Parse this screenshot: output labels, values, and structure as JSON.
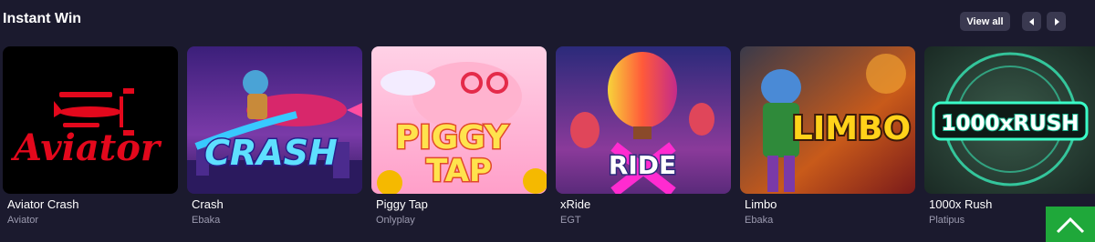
{
  "section": {
    "title": "Instant Win",
    "view_all_label": "View all"
  },
  "colors": {
    "background": "#1b1a2e",
    "button_bg": "#3a3950",
    "provider_text": "#9c9bb0",
    "scroll_top_bg": "#1fa83a"
  },
  "games": [
    {
      "name": "Aviator Crash",
      "provider": "Aviator",
      "logo_text": "Aviator"
    },
    {
      "name": "Crash",
      "provider": "Ebaka",
      "logo_text": "CRASH"
    },
    {
      "name": "Piggy Tap",
      "provider": "Onlyplay",
      "logo_line1": "PIGGY",
      "logo_line2": "TAP"
    },
    {
      "name": "xRide",
      "provider": "EGT",
      "logo_text": "RIDE"
    },
    {
      "name": "Limbo",
      "provider": "Ebaka",
      "logo_text": "LIMBO"
    },
    {
      "name": "1000x Rush",
      "provider": "Platipus",
      "logo_text": "1000xRUSH"
    }
  ]
}
